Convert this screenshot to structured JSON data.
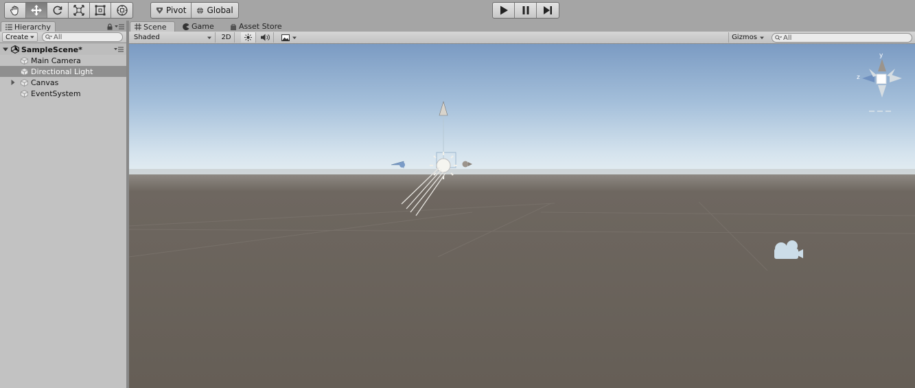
{
  "toolbar": {
    "tools": [
      "hand-icon",
      "move-icon",
      "rotate-icon",
      "scale-icon",
      "rect-icon",
      "transform-icon"
    ],
    "active_tool": "move-icon",
    "pivot_label": "Pivot",
    "global_label": "Global",
    "play_controls": [
      "play-icon",
      "pause-icon",
      "step-icon"
    ]
  },
  "hierarchy": {
    "tab_label": "Hierarchy",
    "create_label": "Create",
    "search_placeholder": "All",
    "scene_name": "SampleScene*",
    "items": [
      {
        "label": "Main Camera",
        "selected": false,
        "has_children": false
      },
      {
        "label": "Directional Light",
        "selected": true,
        "has_children": false
      },
      {
        "label": "Canvas",
        "selected": false,
        "has_children": true
      },
      {
        "label": "EventSystem",
        "selected": false,
        "has_children": false
      }
    ]
  },
  "scene_view": {
    "tabs": [
      {
        "label": "Scene",
        "active": true,
        "icon": "grid-icon"
      },
      {
        "label": "Game",
        "active": false,
        "icon": "pacman-icon"
      },
      {
        "label": "Asset Store",
        "active": false,
        "icon": "bag-icon"
      }
    ],
    "draw_mode": "Shaded",
    "mode_2d_label": "2D",
    "gizmos_label": "Gizmos",
    "search_placeholder": "All",
    "axis_labels": {
      "y": "y",
      "z": "z"
    }
  },
  "colors": {
    "sky_top": "#7f9fc6",
    "horizon": "#dfe9ef",
    "ground": "#655e56",
    "selection": "#8f8f8f"
  }
}
